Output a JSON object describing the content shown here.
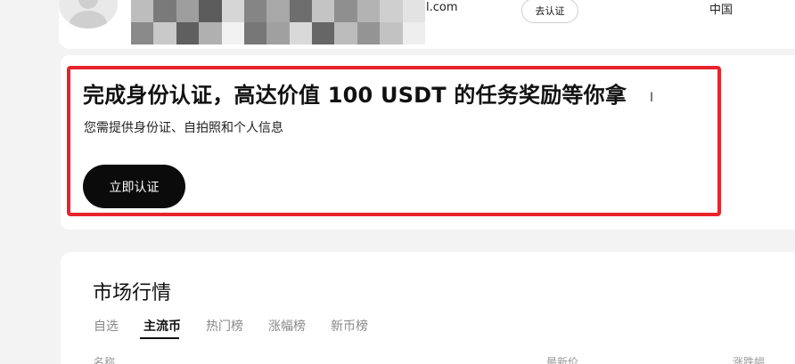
{
  "profile": {
    "email_suffix": "l.com",
    "verify_button": "去认证",
    "region": "中国",
    "mosaic_colors": [
      "#bdbdbd",
      "#7a7a7a",
      "#9e9e9e",
      "#5c5c5c",
      "#d6d6d6",
      "#858585",
      "#a8a8a8",
      "#6e6e6e",
      "#c4c4c4",
      "#8f8f8f",
      "#b3b3b3",
      "#cfcfcf",
      "#e3e3e3",
      "#8a8a8a",
      "#c9c9c9",
      "#5f5f5f",
      "#b0b0b0",
      "#f2f2f2",
      "#777777",
      "#a0a0a0",
      "#d9d9d9",
      "#666666",
      "#bcbcbc",
      "#949494",
      "#c2c2c2",
      "#eeeeee"
    ]
  },
  "kyc": {
    "title": "完成身份认证，高达价值 100 USDT 的任务奖励等你拿",
    "subtitle": "您需提供身份证、自拍照和个人信息",
    "button": "立即认证",
    "frame_color": "#e8232b"
  },
  "market": {
    "title": "市场行情",
    "tabs": [
      {
        "label": "自选",
        "active": false
      },
      {
        "label": "主流币",
        "active": true
      },
      {
        "label": "热门榜",
        "active": false
      },
      {
        "label": "涨幅榜",
        "active": false
      },
      {
        "label": "新币榜",
        "active": false
      }
    ],
    "columns": {
      "name": "名称",
      "price": "最新价",
      "change": "涨跌幅"
    }
  }
}
